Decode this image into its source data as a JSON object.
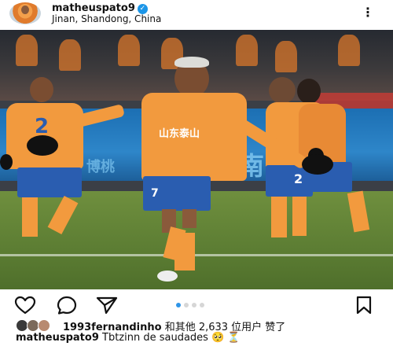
{
  "header": {
    "username": "matheuspato9",
    "verified_icon": "verified-badge-icon",
    "location": "Jinan, Shandong, China",
    "more_icon": "more-options-icon",
    "more_glyph": "⋮"
  },
  "photo": {
    "shirt_sponsor": "山东泰山",
    "banner_text": "济南",
    "banner_text_left": "博桃",
    "player_numbers": [
      "7",
      "2",
      "2"
    ]
  },
  "actions": {
    "like_icon": "heart-icon",
    "comment_icon": "comment-icon",
    "share_icon": "send-icon",
    "save_icon": "bookmark-icon",
    "carousel_dots": 4,
    "carousel_active": 0
  },
  "likes": {
    "user": "1993fernandinho",
    "rest": " 和其他 2,633 位用户 赞了"
  },
  "caption": {
    "user": "matheuspato9",
    "text": " Tbtzinn de saudades 🥺 ⏳"
  },
  "colors": {
    "accent": "#2e95e8",
    "kit_orange": "#f29a3e",
    "kit_blue": "#2a5db0"
  }
}
